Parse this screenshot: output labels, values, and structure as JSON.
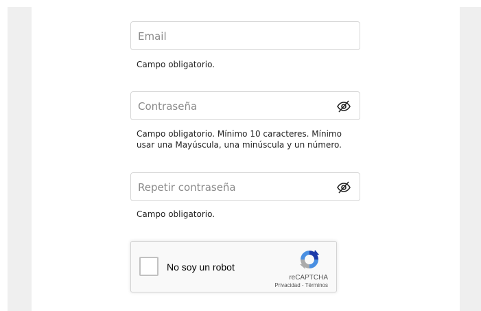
{
  "form": {
    "email": {
      "placeholder": "Email",
      "hint": "Campo obligatorio."
    },
    "password": {
      "placeholder": "Contraseña",
      "hint": "Campo obligatorio. Mínimo 10 caracteres. Mínimo usar una Mayúscula, una minúscula y un número.",
      "toggle_icon": "eye-off-icon"
    },
    "repeat_password": {
      "placeholder": "Repetir contraseña",
      "hint": "Campo obligatorio.",
      "toggle_icon": "eye-off-icon"
    }
  },
  "recaptcha": {
    "label": "No soy un robot",
    "brand": "reCAPTCHA",
    "terms": "Privacidad - Términos",
    "icon": "recaptcha-logo-icon"
  },
  "colors": {
    "gutter": "#efefef",
    "border": "#d6d6d6",
    "placeholder": "#8a8a8a"
  }
}
